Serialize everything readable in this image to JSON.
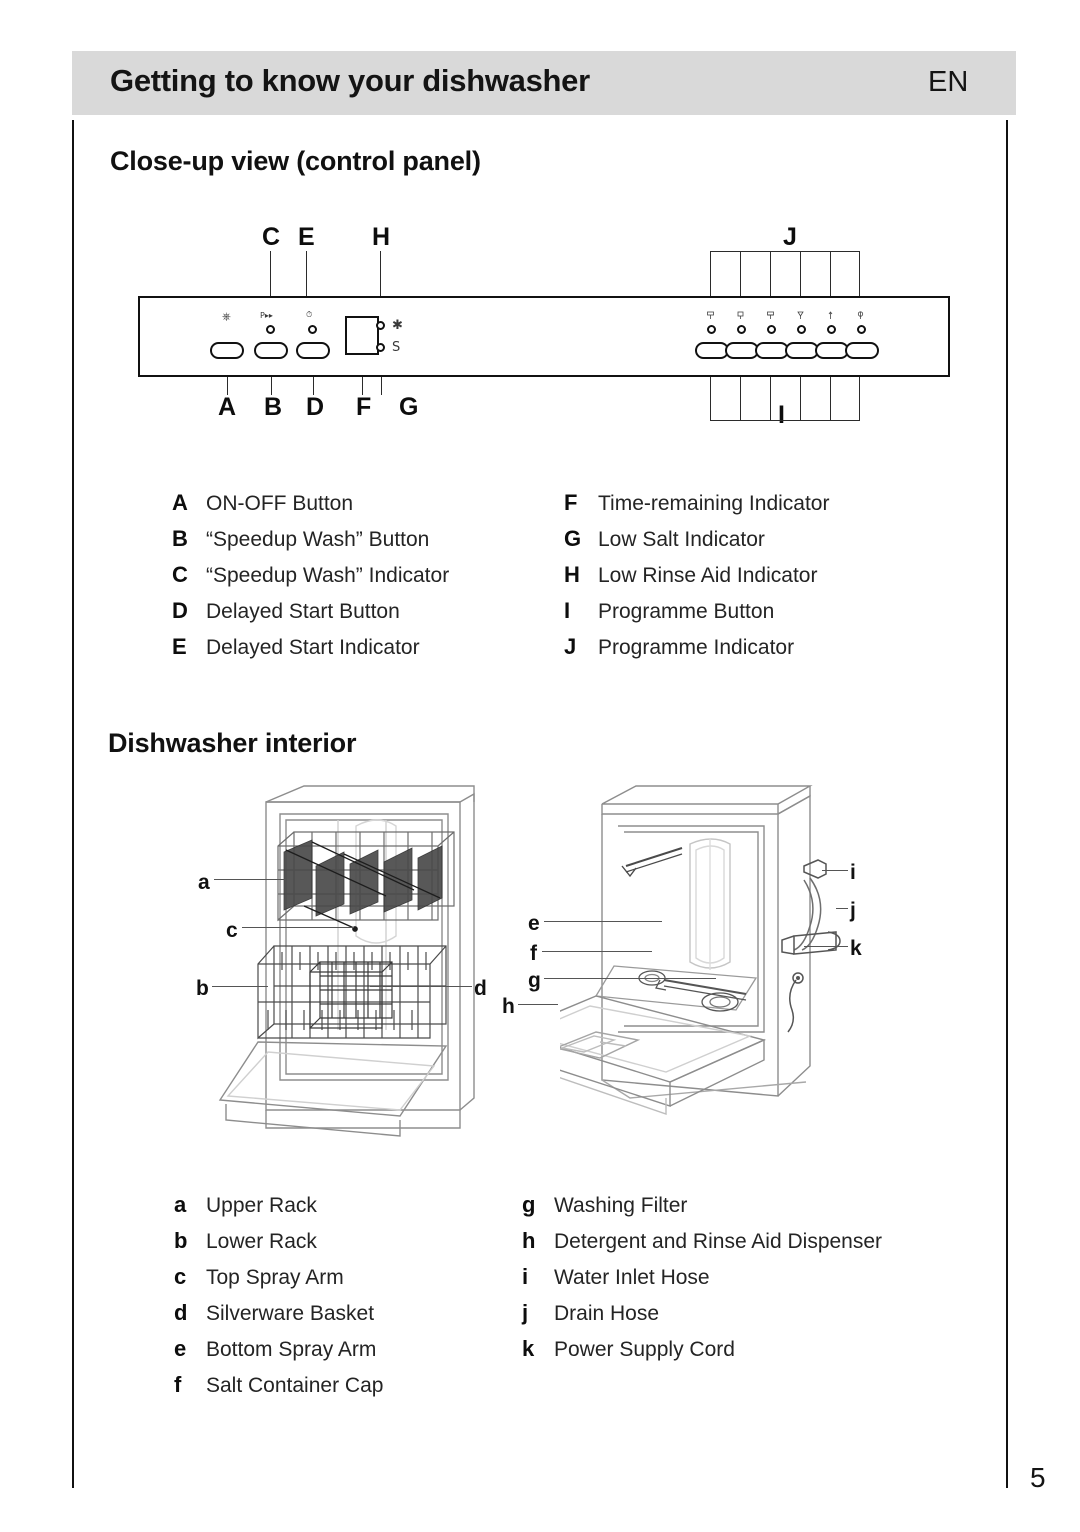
{
  "header": {
    "title": "Getting to know your dishwasher",
    "language": "EN"
  },
  "page_number": "5",
  "sections": {
    "control_panel": {
      "heading": "Close-up view (control panel)",
      "diagram_tags_top": [
        "C",
        "E",
        "H",
        "J"
      ],
      "diagram_tags_bottom": [
        "A",
        "B",
        "D",
        "F",
        "G",
        "I"
      ],
      "panel_icons": {
        "power": "power-symbol",
        "speedup": "P-fast-forward",
        "delay": "clock-symbol",
        "display": "time-remaining-display",
        "rinse_aid": "star-symbol",
        "salt": "S-symbol"
      },
      "programme_count": 6,
      "legend_left": [
        {
          "key": "A",
          "label": "ON-OFF Button"
        },
        {
          "key": "B",
          "label": "“Speedup Wash” Button"
        },
        {
          "key": "C",
          "label": "“Speedup Wash” Indicator"
        },
        {
          "key": "D",
          "label": "Delayed Start Button"
        },
        {
          "key": "E",
          "label": "Delayed Start Indicator"
        }
      ],
      "legend_right": [
        {
          "key": "F",
          "label": "Time-remaining Indicator"
        },
        {
          "key": "G",
          "label": "Low Salt Indicator"
        },
        {
          "key": "H",
          "label": "Low Rinse Aid Indicator"
        },
        {
          "key": "I",
          "label": "Programme Button"
        },
        {
          "key": "J",
          "label": "Programme Indicator"
        }
      ]
    },
    "interior": {
      "heading": "Dishwasher interior",
      "callouts_left_figure": [
        "a",
        "c",
        "b",
        "d"
      ],
      "callouts_right_figure": [
        "e",
        "f",
        "g",
        "h",
        "i",
        "j",
        "k"
      ],
      "legend_left": [
        {
          "key": "a",
          "label": "Upper Rack"
        },
        {
          "key": "b",
          "label": "Lower Rack"
        },
        {
          "key": "c",
          "label": "Top Spray Arm"
        },
        {
          "key": "d",
          "label": "Silverware Basket"
        },
        {
          "key": "e",
          "label": "Bottom Spray Arm"
        },
        {
          "key": "f",
          "label": "Salt Container Cap"
        }
      ],
      "legend_right": [
        {
          "key": "g",
          "label": "Washing Filter"
        },
        {
          "key": "h",
          "label": "Detergent and Rinse Aid Dispenser"
        },
        {
          "key": "i",
          "label": "Water Inlet Hose"
        },
        {
          "key": "j",
          "label": "Drain Hose"
        },
        {
          "key": "k",
          "label": "Power Supply Cord"
        }
      ]
    }
  },
  "colors": {
    "header_bar": "#d9d9d9",
    "text": "#141414",
    "rule": "#111111",
    "line_art": "#555555"
  }
}
